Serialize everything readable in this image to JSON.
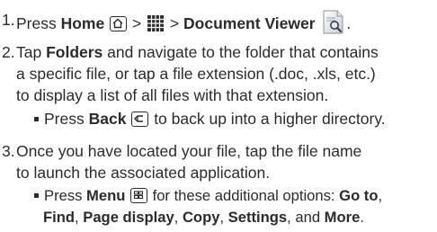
{
  "steps": [
    {
      "number": "1.",
      "lines": [
        {
          "t1": "Press ",
          "home": "Home",
          "gt1": " > ",
          "gt2": " > ",
          "docviewer": "Document Viewer",
          "end": "."
        }
      ]
    },
    {
      "number": "2.",
      "lines": [
        {
          "pre": "Tap ",
          "folders": "Folders",
          "post": " and navigate to the folder that contains"
        },
        {
          "text": "a specific file, or tap a file extension (.doc, .xls, etc.)"
        },
        {
          "text": "to display a list of all files with that extension."
        }
      ],
      "sub": {
        "pre": "Press ",
        "back": "Back",
        "post": " to back up into a higher directory."
      }
    },
    {
      "number": "3.",
      "lines": [
        {
          "text": "Once you have located your file, tap the file name"
        },
        {
          "text": "to launch the associated application."
        }
      ],
      "sub": {
        "pre": "Press ",
        "menu": "Menu",
        "post": " for these additional options: ",
        "opt1": "Go to",
        "comma1": ",",
        "opt2": "Find",
        "comma2": ", ",
        "opt3": "Page display",
        "comma3": ", ",
        "opt4": "Copy",
        "comma4": ", ",
        "opt5": "Settings",
        "and": ", and ",
        "opt6": "More",
        "end": "."
      }
    }
  ],
  "icons": [
    "home-key-icon",
    "apps-grid-icon",
    "document-viewer-icon",
    "back-key-icon",
    "menu-key-icon"
  ]
}
